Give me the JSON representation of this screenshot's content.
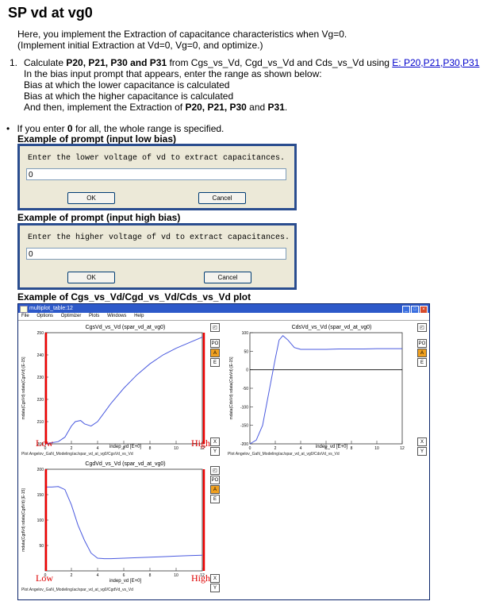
{
  "title": "SP vd at vg0",
  "intro": {
    "line1": "Here, you implement the Extraction of capacitance characteristics when Vg=0.",
    "line2": "(Implement initial Extraction at Vd=0, Vg=0, and optimize.)"
  },
  "step1": {
    "num": "1.",
    "pre": "Calculate ",
    "bold": "P20, P21, P30 and P31",
    "mid": " from Cgs_vs_Vd, Cgd_vs_Vd and Cds_vs_Vd using ",
    "link": "E: P20,P21,P30,P31",
    "line2": "In the bias input prompt that appears, enter the range as shown below:",
    "line3": "Bias at which the lower capacitance is calculated",
    "line4": "Bias at which the higher capacitance is calculated",
    "line5_pre": "And then, implement the Extraction of ",
    "line5_bold": "P20, P21, P30",
    "line5_and": " and ",
    "line5_bold2": "P31",
    "line5_end": "."
  },
  "bullet": {
    "pre": "If you enter ",
    "bold": "0",
    "post": " for all, the whole range is specified."
  },
  "ex_low": {
    "heading": "Example of prompt (input low bias)",
    "prompt": "Enter the lower voltage of vd to extract capacitances.",
    "value": "0",
    "ok": "OK",
    "cancel": "Cancel"
  },
  "ex_high": {
    "heading": "Example of prompt (input high bias)",
    "prompt": "Enter the higher voltage of vd to extract capacitances.",
    "value": "0",
    "ok": "OK",
    "cancel": "Cancel"
  },
  "ex_plot_heading": "Example of Cgs_vs_Vd/Cgd_vs_Vd/Cds_vs_Vd plot",
  "window": {
    "title": "multiplot_table:12",
    "menu": [
      "File",
      "Options",
      "Optimizer",
      "Plots",
      "Windows",
      "Help"
    ],
    "side_po": "PO",
    "side_a": "A",
    "side_e": "E",
    "side_x": "X",
    "side_y": "Y",
    "low": "Low",
    "high": "High"
  },
  "chart_data": [
    {
      "type": "line",
      "title": "CgsVd_vs_Vd (spar_vd_at_vg0)",
      "xlabel": "indep_vd [E+0]",
      "ylabel": "mdata(CgsVd) sdata(CgsVd) [E-15]",
      "path_label": "Plot Angelov_GaN_Modeling/ac/spar_vd_at_vg0/CgsVd_vs_Vd",
      "xlim": [
        0,
        12
      ],
      "ylim": [
        200,
        250
      ],
      "xticks": [
        "0",
        "2",
        "4",
        "6",
        "8",
        "10",
        "12"
      ],
      "yticks": [
        "200",
        "210",
        "220",
        "230",
        "240",
        "250"
      ],
      "x": [
        0,
        0.5,
        1,
        1.5,
        2,
        2.3,
        2.7,
        3,
        3.5,
        4,
        4.5,
        5,
        6,
        7,
        8,
        9,
        10,
        11,
        12
      ],
      "y": [
        200,
        200.5,
        201,
        203,
        208,
        210,
        210.5,
        209,
        208,
        210,
        214,
        218,
        225,
        231,
        236,
        240,
        243,
        245.5,
        248
      ]
    },
    {
      "type": "line",
      "title": "CdsVd_vs_Vd (spar_vd_at_vg0)",
      "xlabel": "indep_vd [E+0]",
      "ylabel": "mdata(CdsVd) sdata(CdsVd) [E-15]",
      "path_label": "Plot Angelov_GaN_Modeling/ac/spar_vd_at_vg0/CdsVd_vs_Vd",
      "xlim": [
        0,
        12
      ],
      "ylim": [
        -200,
        100
      ],
      "xticks": [
        "0",
        "2",
        "4",
        "6",
        "8",
        "10",
        "12"
      ],
      "yticks": [
        "-200",
        "-150",
        "-100",
        "-50",
        "0",
        "50",
        "100"
      ],
      "x": [
        0,
        0.5,
        1,
        1.5,
        2,
        2.3,
        2.6,
        3,
        3.5,
        4,
        5,
        6,
        7,
        8,
        9,
        10,
        11,
        12
      ],
      "y": [
        -200,
        -190,
        -150,
        -60,
        30,
        80,
        92,
        80,
        60,
        55,
        55,
        55,
        56,
        56,
        56,
        57,
        57,
        57
      ]
    },
    {
      "type": "line",
      "title": "CgdVd_vs_Vd (spar_vd_at_vg0)",
      "xlabel": "indep_vd [E+0]",
      "ylabel": "mdata(CgdVd) sdata(CgdVd) [E-15]",
      "path_label": "Plot Angelov_GaN_Modeling/ac/spar_vd_at_vg0/CgdVd_vs_Vd",
      "xlim": [
        0,
        12
      ],
      "ylim": [
        0,
        200
      ],
      "xticks": [
        "0",
        "2",
        "4",
        "6",
        "8",
        "10",
        "12"
      ],
      "yticks": [
        "50",
        "100",
        "150",
        "200"
      ],
      "x": [
        0,
        0.5,
        1,
        1.5,
        2,
        2.5,
        3,
        3.5,
        4,
        4.5,
        5,
        6,
        7,
        8,
        9,
        10,
        11,
        12
      ],
      "y": [
        165,
        165,
        166,
        160,
        130,
        90,
        60,
        35,
        25,
        24,
        24,
        25,
        26,
        27,
        28,
        29,
        30,
        31
      ]
    }
  ]
}
